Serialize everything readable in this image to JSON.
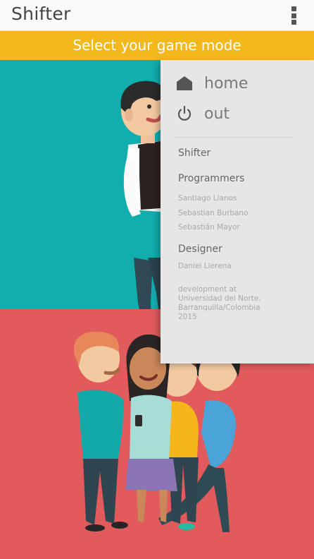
{
  "app": {
    "title": "Shifter"
  },
  "banner": {
    "text": "Select your game mode"
  },
  "menu": {
    "items": [
      {
        "label": "home",
        "icon": "home-icon"
      },
      {
        "label": "out",
        "icon": "power-icon"
      }
    ]
  },
  "credits": {
    "app_name": "Shifter",
    "programmers_heading": "Programmers",
    "programmers": [
      "Santiago Llanos",
      "Sebastian Burbano",
      "Sebastián Mayor"
    ],
    "designer_heading": "Designer",
    "designer": "Daniel Llerena",
    "development_lines": [
      "development at",
      "Universidad del Norte.",
      "Barranquilla/Colombia",
      "2015"
    ]
  },
  "colors": {
    "banner": "#f2b81c",
    "single_mode_bg": "#12adad",
    "group_mode_bg": "#e15a5c",
    "drawer_bg": "#e6e6e6"
  }
}
